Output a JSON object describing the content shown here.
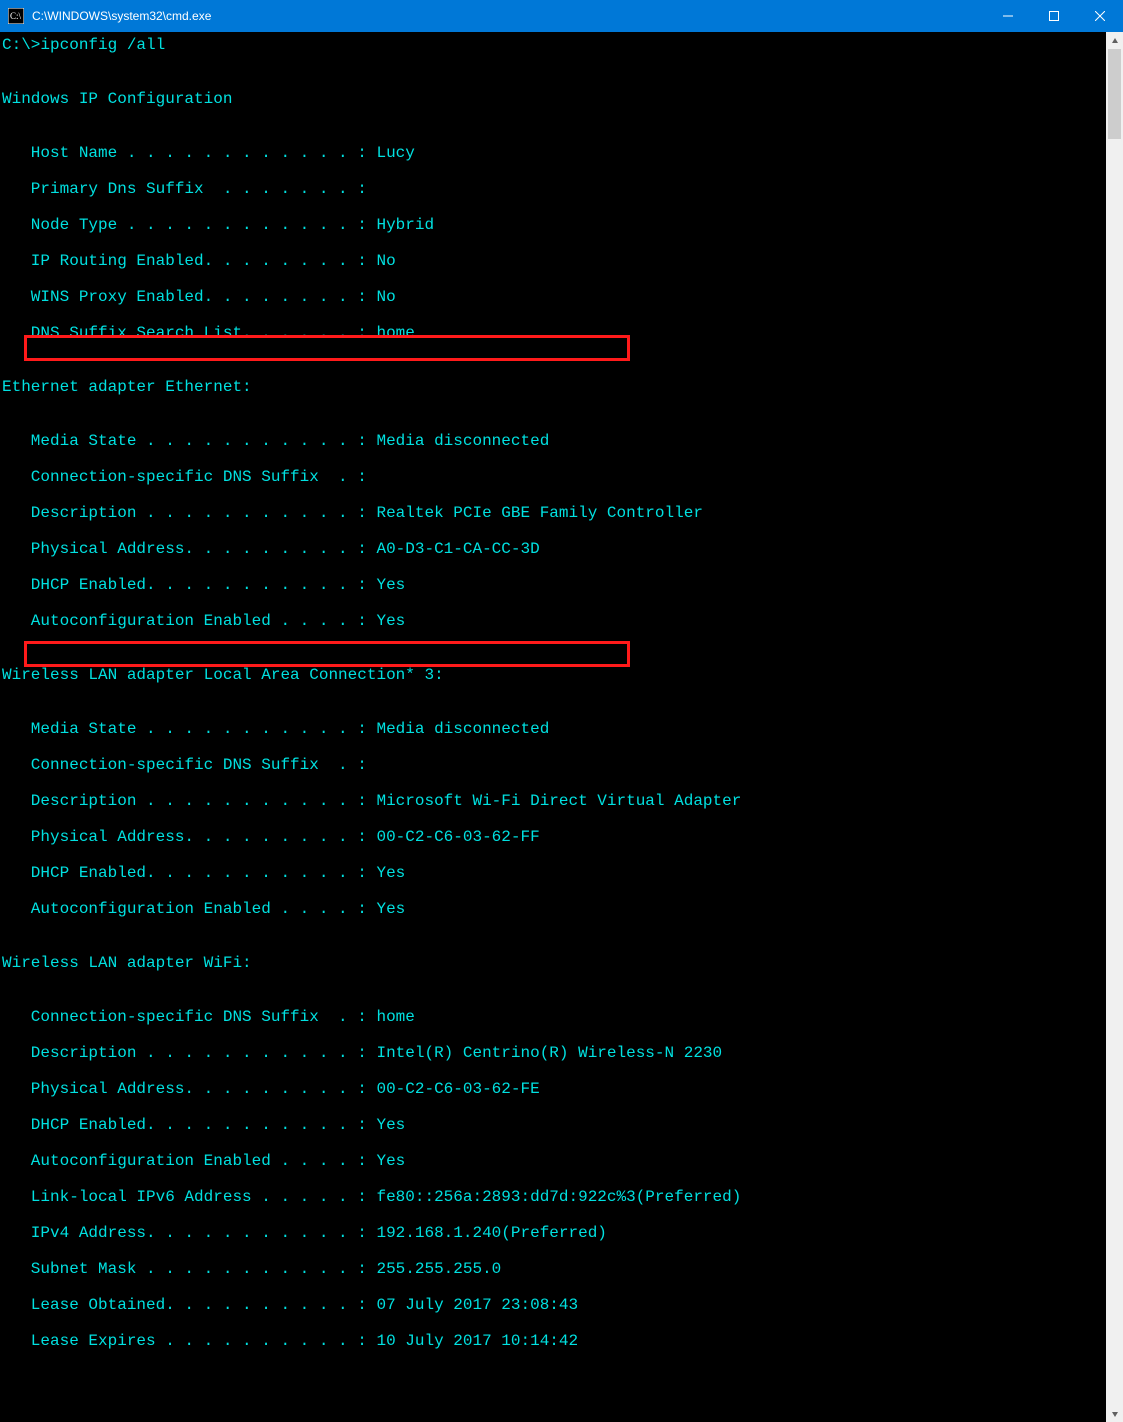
{
  "title": "C:\\WINDOWS\\system32\\cmd.exe",
  "prompt": "C:\\>ipconfig /all",
  "section_ipconfig": "Windows IP Configuration",
  "cfg": {
    "host": "   Host Name . . . . . . . . . . . . : Lucy",
    "primary": "   Primary Dns Suffix  . . . . . . . :",
    "nodetype": "   Node Type . . . . . . . . . . . . : Hybrid",
    "routing": "   IP Routing Enabled. . . . . . . . : No",
    "wins": "   WINS Proxy Enabled. . . . . . . . : No",
    "dnslist": "   DNS Suffix Search List. . . . . . : home"
  },
  "section_eth": "Ethernet adapter Ethernet:",
  "eth": {
    "media": "   Media State . . . . . . . . . . . : Media disconnected",
    "connsuffix": "   Connection-specific DNS Suffix  . :",
    "desc": "   Description . . . . . . . . . . . : Realtek PCIe GBE Family Controller",
    "phys": "   Physical Address. . . . . . . . . : A0-D3-C1-CA-CC-3D",
    "dhcp": "   DHCP Enabled. . . . . . . . . . . : Yes",
    "autocfg": "   Autoconfiguration Enabled . . . . : Yes"
  },
  "section_wlan3": "Wireless LAN adapter Local Area Connection* 3:",
  "wlan3": {
    "media": "   Media State . . . . . . . . . . . : Media disconnected",
    "connsuffix": "   Connection-specific DNS Suffix  . :",
    "desc": "   Description . . . . . . . . . . . : Microsoft Wi-Fi Direct Virtual Adapter",
    "phys": "   Physical Address. . . . . . . . . : 00-C2-C6-03-62-FF",
    "dhcp": "   DHCP Enabled. . . . . . . . . . . : Yes",
    "autocfg": "   Autoconfiguration Enabled . . . . : Yes"
  },
  "section_wifi": "Wireless LAN adapter WiFi:",
  "wifi": {
    "connsuffix": "   Connection-specific DNS Suffix  . : home",
    "desc": "   Description . . . . . . . . . . . : Intel(R) Centrino(R) Wireless-N 2230",
    "phys": "   Physical Address. . . . . . . . . : 00-C2-C6-03-62-FE",
    "dhcp": "   DHCP Enabled. . . . . . . . . . . : Yes",
    "autocfg": "   Autoconfiguration Enabled . . . . : Yes",
    "linklocal": "   Link-local IPv6 Address . . . . . : fe80::256a:2893:dd7d:922c%3(Preferred)",
    "ipv4": "   IPv4 Address. . . . . . . . . . . : 192.168.1.240(Preferred)",
    "subnet": "   Subnet Mask . . . . . . . . . . . : 255.255.255.0",
    "leaseobt": "   Lease Obtained. . . . . . . . . . : 07 July 2017 23:08:43",
    "leaseexp": "   Lease Expires . . . . . . . . . . : 10 July 2017 10:14:42"
  }
}
